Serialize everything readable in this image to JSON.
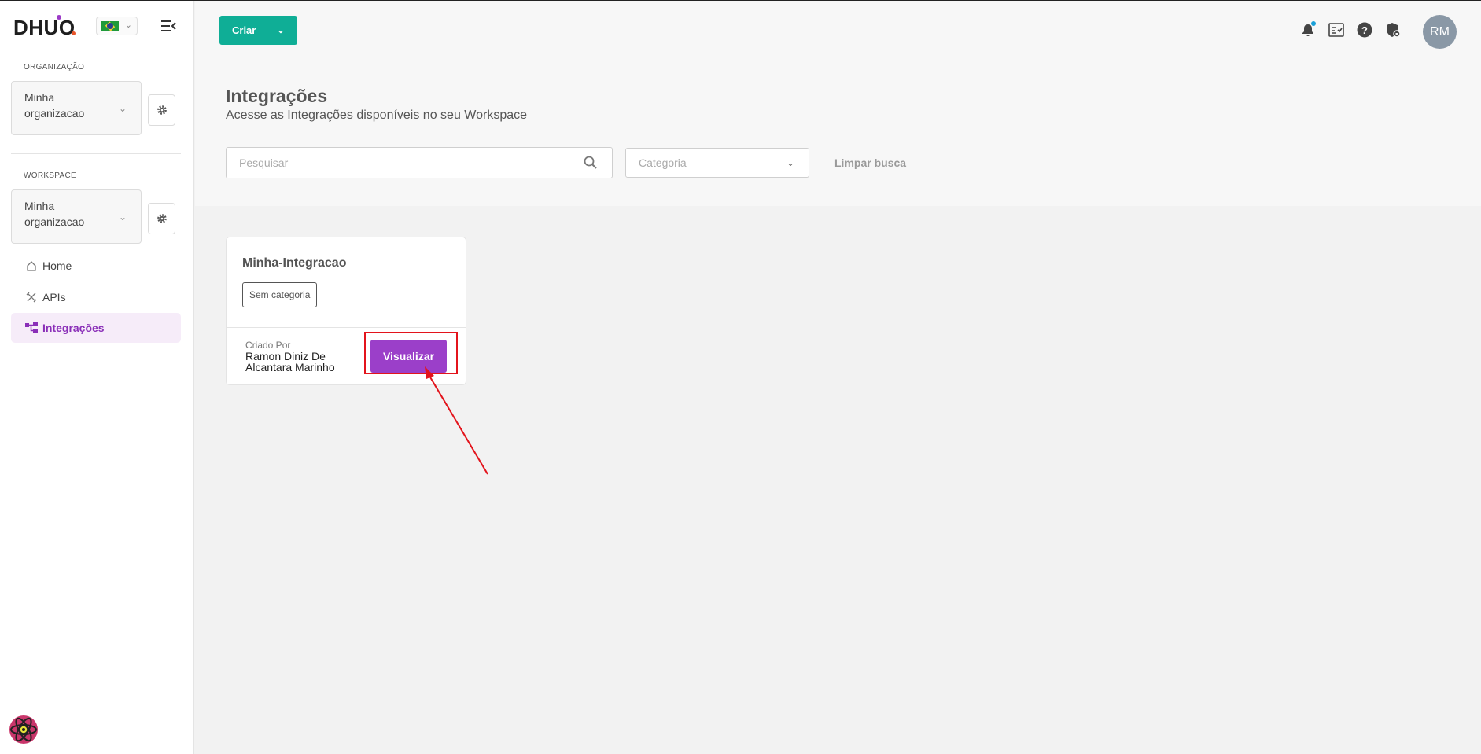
{
  "app": {
    "logo": "DHUO"
  },
  "sidebar": {
    "org_label": "ORGANIZAÇÃO",
    "org_value": "Minha organizacao",
    "workspace_label": "WORKSPACE",
    "workspace_value": "Minha organizacao",
    "items": [
      {
        "label": "Home",
        "icon": "home-icon"
      },
      {
        "label": "APIs",
        "icon": "tools-icon"
      },
      {
        "label": "Integrações",
        "icon": "integration-icon",
        "active": true
      }
    ]
  },
  "topbar": {
    "create_label": "Criar",
    "avatar_initials": "RM",
    "icons": [
      "bell-icon",
      "checklist-icon",
      "help-icon",
      "security-icon"
    ]
  },
  "header": {
    "title": "Integrações",
    "subtitle": "Acesse as Integrações disponíveis no seu Workspace",
    "search_placeholder": "Pesquisar",
    "category_placeholder": "Categoria",
    "clear_label": "Limpar busca"
  },
  "cards": [
    {
      "title": "Minha-Integracao",
      "tag": "Sem categoria",
      "created_by_label": "Criado Por",
      "created_by": "Ramon Diniz De Alcantara Marinho",
      "action_label": "Visualizar"
    }
  ],
  "colors": {
    "primary": "#0fae96",
    "accent": "#9b3fc9",
    "annotation": "#e3141c"
  }
}
